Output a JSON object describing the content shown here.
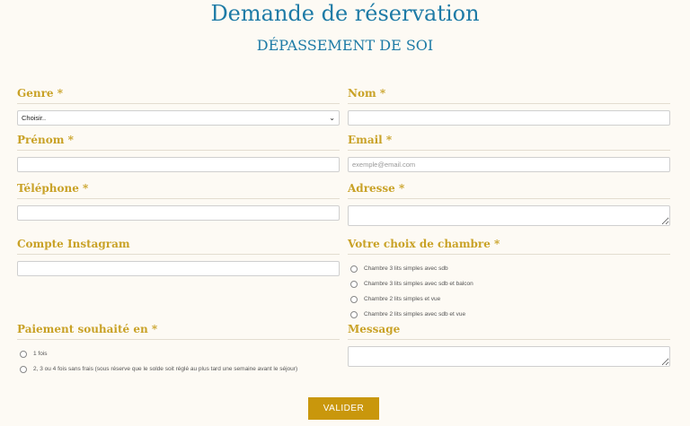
{
  "page": {
    "title": "Demande de réservation",
    "subtitle": "DÉPASSEMENT DE SOI"
  },
  "fields": {
    "genre": {
      "label": "Genre *",
      "selected": "Choisir..",
      "icon": "chevron-down-icon"
    },
    "nom": {
      "label": "Nom *",
      "value": ""
    },
    "prenom": {
      "label": "Prénom *",
      "value": ""
    },
    "email": {
      "label": "Email *",
      "placeholder": "exemple@email.com",
      "value": ""
    },
    "telephone": {
      "label": "Téléphone *",
      "value": ""
    },
    "adresse": {
      "label": "Adresse *",
      "value": ""
    },
    "instagram": {
      "label": "Compte Instagram",
      "value": ""
    },
    "chambre": {
      "label": "Votre choix de chambre *",
      "options": [
        "Chambre 3 lits simples avec sdb",
        "Chambre 3 lits simples avec sdb et balcon",
        "Chambre 2 lits simples et vue",
        "Chambre 2 lits simples avec sdb et vue"
      ]
    },
    "paiement": {
      "label": "Paiement souhaité en *",
      "options": [
        "1 fois",
        "2, 3 ou 4 fois sans frais (sous réserve que le solde soit réglé au plus tard une semaine avant le séjour)"
      ]
    },
    "message": {
      "label": "Message",
      "value": ""
    }
  },
  "submit": {
    "label": "VALIDER"
  },
  "colors": {
    "accent_blue": "#1e7ba6",
    "label_gold": "#c9a227",
    "button_gold": "#c9970c",
    "background": "#fdfaf4"
  }
}
